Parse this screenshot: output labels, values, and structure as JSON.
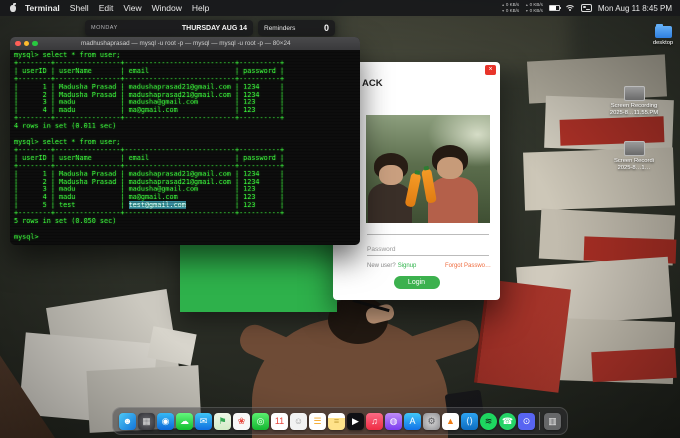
{
  "menu_bar": {
    "menus": [
      "Terminal",
      "Shell",
      "Edit",
      "View",
      "Window",
      "Help"
    ],
    "status": {
      "net1_up": "0 KB/s",
      "net1_down": "0 KB/s",
      "net2_up": "0 KB/s",
      "net2_down": "0 KB/s",
      "date": "Mon Aug 11",
      "time": "8:45 PM"
    }
  },
  "icons": {
    "up_arrow": "▲",
    "down_arrow": "▼",
    "close_glyph": "×"
  },
  "widgets": {
    "calendar": {
      "day": "MONDAY",
      "event": "THURSDAY AUG 14"
    },
    "reminders": {
      "title": "Reminders",
      "count": "0"
    }
  },
  "terminal": {
    "title": "madhushaprasad — mysql -u root -p — mysql — mysql -u root -p — 80×24",
    "body_before": "mysql> select * from user;\n+--------+----------------+---------------------------+----------+\n| userID | userName       | email                     | password |\n+--------+----------------+---------------------------+----------+\n|      1 | Madusha Prasad | madushaprasad21@gmail.com | 1234     |\n|      2 | Madusha Prasad | madushaprasad21@gmail.com | 1234     |\n|      3 | madu           | madusha@gmail.com         | 123      |\n|      4 | madu           | ma@gmail.com              | 123      |\n+--------+----------------+---------------------------+----------+\n4 rows in set (0.011 sec)\n\nmysql> select * from user;\n+--------+----------------+---------------------------+----------+\n| userID | userName       | email                     | password |\n+--------+----------------+---------------------------+----------+\n|      1 | Madusha Prasad | madushaprasad21@gmail.com | 1234     |\n|      2 | Madusha Prasad | madushaprasad21@gmail.com | 1234     |\n|      3 | madu           | madusha@gmail.com         | 123      |\n|      4 | madu           | ma@gmail.com              | 123      |\n|      5 | test           | ",
    "selection": "test@gmail.com",
    "body_after": "            | 123      |\n+--------+----------------+---------------------------+----------+\n5 rows in set (0.050 sec)\n\nmysql> "
  },
  "app_window": {
    "accent_green": "#2eb14b"
  },
  "login_window": {
    "title": "ACK",
    "password_placeholder": "Password",
    "new_user_text": "New user?",
    "signup_link": "Signup",
    "signup_color": "#2db34a",
    "forgot_link": "Forgot Passwo…",
    "forgot_color": "#ef6c3f",
    "login_button": "Login",
    "accent_color": "#3cb14e"
  },
  "desktop_icons": {
    "folder_label": "desktop",
    "recordings": [
      {
        "line1": "Screen Recording",
        "line2": "2025-8…11.55.PM"
      },
      {
        "line1": "Screen Recordi",
        "line2": "2025-8…1…"
      }
    ]
  },
  "dock": {
    "items": [
      {
        "name": "finder",
        "bg": "linear-gradient(135deg,#4ec9f5,#1374d8)",
        "glyph": "☻",
        "fg": "#ffffff"
      },
      {
        "name": "launchpad",
        "bg": "radial-gradient(#6a6a70,#2e2e33)",
        "glyph": "▦",
        "fg": "#dddddd"
      },
      {
        "name": "safari",
        "bg": "linear-gradient(#35b9f5,#0d68d8)",
        "glyph": "◉",
        "fg": "#ffffff"
      },
      {
        "name": "messages",
        "bg": "linear-gradient(#63f77d,#12bd2e)",
        "glyph": "☁",
        "fg": "#ffffff"
      },
      {
        "name": "mail",
        "bg": "linear-gradient(#3ec5f5,#0f6fe0)",
        "glyph": "✉",
        "fg": "#ffffff"
      },
      {
        "name": "maps",
        "bg": "linear-gradient(#eef6e8,#d4ecc8)",
        "glyph": "⚑",
        "fg": "#34a853"
      },
      {
        "name": "photos",
        "bg": "#f7f7f7",
        "glyph": "❀",
        "fg": "#e8453c"
      },
      {
        "name": "facetime",
        "bg": "linear-gradient(#5bf06f,#14b531)",
        "glyph": "◎",
        "fg": "#ffffff"
      },
      {
        "name": "calendar",
        "bg": "#ffffff",
        "glyph": "11",
        "fg": "#e8453c"
      },
      {
        "name": "contacts",
        "bg": "#f2f2f2",
        "glyph": "☺",
        "fg": "#9a9a9a"
      },
      {
        "name": "reminders",
        "bg": "#ffffff",
        "glyph": "☰",
        "fg": "#f5a623"
      },
      {
        "name": "notes",
        "bg": "linear-gradient(#ffffff 30%,#ffe28a 30%)",
        "glyph": "≡",
        "fg": "#c7a23c"
      },
      {
        "name": "tv",
        "bg": "#101014",
        "glyph": "▶",
        "fg": "#ffffff"
      },
      {
        "name": "music",
        "bg": "linear-gradient(#fc6a84,#ef2d44)",
        "glyph": "♫",
        "fg": "#ffffff"
      },
      {
        "name": "podcasts",
        "bg": "linear-gradient(#c08cf7,#7b3bf0)",
        "glyph": "◍",
        "fg": "#ffffff"
      },
      {
        "name": "appstore",
        "bg": "linear-gradient(#41c8f7,#1173e8)",
        "glyph": "A",
        "fg": "#ffffff"
      },
      {
        "name": "settings",
        "bg": "radial-gradient(#d8d8d8,#8e8e92)",
        "glyph": "⚙",
        "fg": "#5a5a5e"
      },
      {
        "name": "vlc",
        "bg": "#ffffff",
        "glyph": "▲",
        "fg": "#f07b12"
      },
      {
        "name": "vscode",
        "bg": "linear-gradient(#2da3f2,#0d6cc0)",
        "glyph": "⟨⟩",
        "fg": "#ffffff"
      },
      {
        "name": "spotify",
        "bg": "#1ed760",
        "round": true,
        "glyph": "≋",
        "fg": "#121212"
      },
      {
        "name": "whatsapp",
        "bg": "#25d366",
        "round": true,
        "glyph": "☎",
        "fg": "#ffffff"
      },
      {
        "name": "discord",
        "bg": "#5865f2",
        "glyph": "⊙",
        "fg": "#ffffff"
      },
      {
        "separator": true
      },
      {
        "name": "trash",
        "bg": "rgba(220,220,225,0.35)",
        "glyph": "▥",
        "fg": "#eeeeee"
      }
    ]
  }
}
